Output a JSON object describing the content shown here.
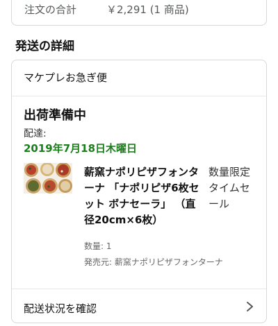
{
  "order_total": {
    "label": "注文の合計",
    "value": "￥2,291 (1 商品)"
  },
  "shipping": {
    "section_title": "発送の詳細",
    "method": "マケプレお急ぎ便",
    "status": "出荷準備中",
    "delivery_label": "配達:",
    "delivery_date": "2019年7月18日木曜日",
    "delivery_date_color": "#1a7f1a",
    "item": {
      "image_icon": "pizza-product-thumbnail",
      "title": "薪窯ナポリピザフォンターナ 「ナポリピザ6枚セット ボナセーラ」 （直径20cm×6枚）",
      "badge": "数量限定タイムセール",
      "quantity": "数量: 1",
      "seller": "発売元: 薪窯ナポリピザフォンターナ"
    },
    "track_label": "配送状況を確認",
    "track_icon": "chevron-right-icon"
  }
}
